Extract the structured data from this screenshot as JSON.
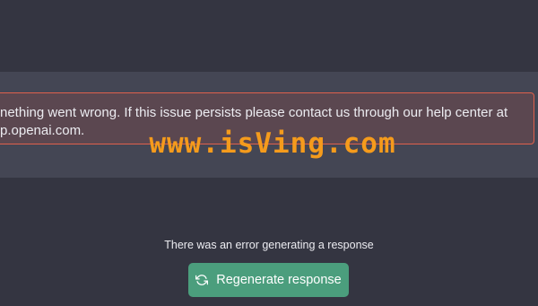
{
  "error_banner": {
    "message": "nething went wrong. If this issue persists please contact us through our help center at\np.openai.com."
  },
  "watermark": {
    "text": "www.isVing.com"
  },
  "status": {
    "text": "There was an error generating a response"
  },
  "regenerate_button": {
    "label": "Regenerate response",
    "icon": "refresh-icon"
  },
  "colors": {
    "background": "#343541",
    "message_row": "#444654",
    "error_border": "#e0614c",
    "error_fill": "#5b4750",
    "button": "#4b9e7d",
    "watermark": "#f59b1c"
  }
}
